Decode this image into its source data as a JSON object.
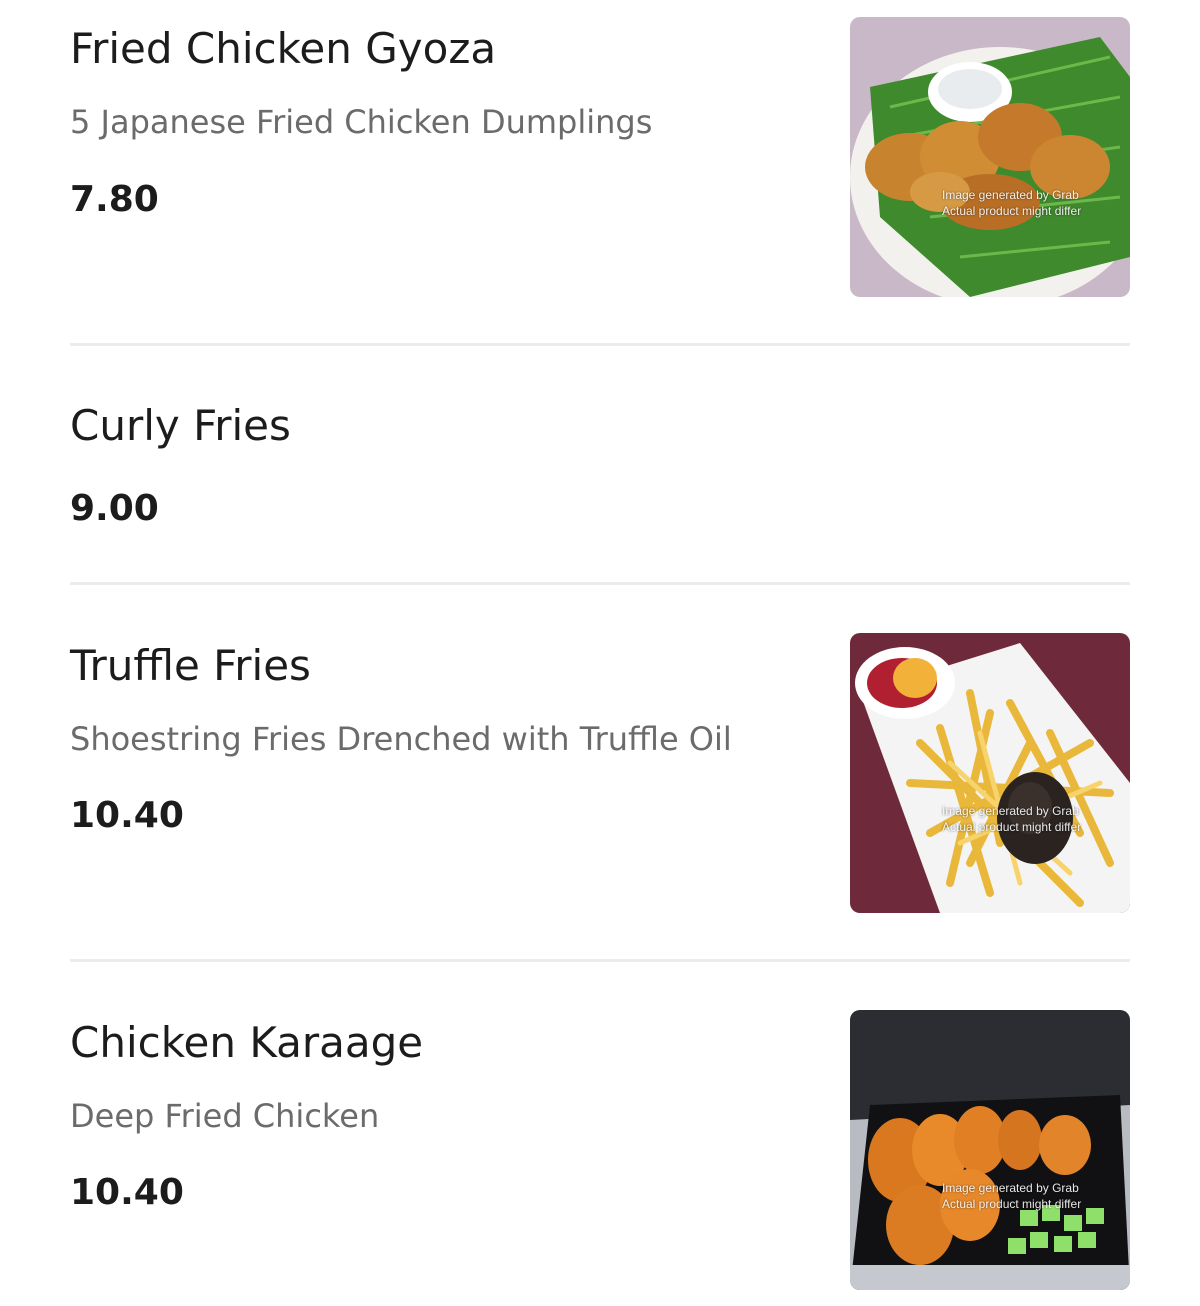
{
  "menu": {
    "items": [
      {
        "name": "Fried Chicken Gyoza",
        "description": "5 Japanese Fried Chicken Dumplings",
        "price": "7.80",
        "image_icon": "fried-gyoza-photo",
        "watermark_line1": "Image generated by Grab",
        "watermark_line2": "Actual product might differ"
      },
      {
        "name": "Curly Fries",
        "price": "9.00"
      },
      {
        "name": "Truffle Fries",
        "description": "Shoestring Fries Drenched with Truffle Oil",
        "price": "10.40",
        "image_icon": "truffle-fries-photo",
        "watermark_line1": "Image generated by Grab",
        "watermark_line2": "Actual product might differ"
      },
      {
        "name": "Chicken Karaage",
        "description": "Deep Fried Chicken",
        "price": "10.40",
        "image_icon": "karaage-photo",
        "watermark_line1": "Image generated by Grab",
        "watermark_line2": "Actual product might differ"
      }
    ]
  },
  "colors": {
    "text_primary": "#1c1c1c",
    "text_secondary": "#6b6b6b",
    "divider": "#ececec"
  }
}
